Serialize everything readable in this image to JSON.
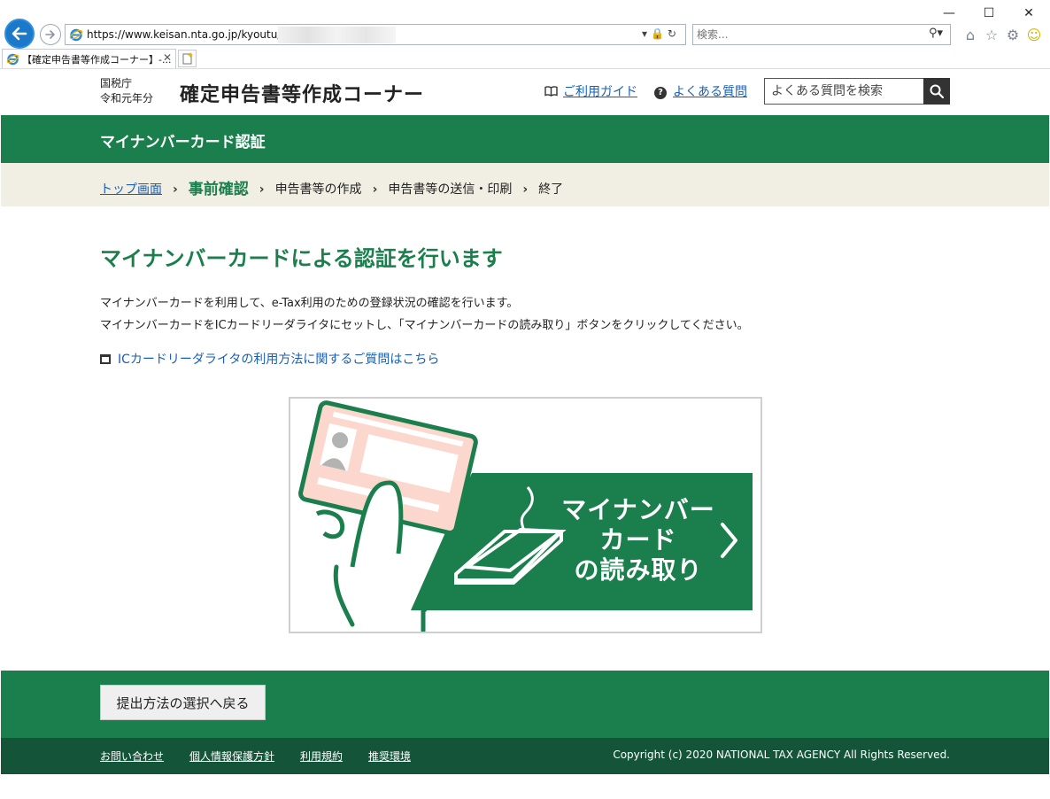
{
  "browser": {
    "url": "https://www.keisan.nta.go.jp/kyoutu/ky/",
    "search_placeholder": "検索...",
    "tab_title": "【確定申告書等作成コーナー】-...",
    "window_controls": {
      "minimize": "—",
      "maximize": "☐",
      "close": "✕"
    }
  },
  "header": {
    "agency_line1": "国税庁",
    "agency_line2": "令和元年分",
    "site_title": "確定申告書等作成コーナー",
    "guide_link": "ご利用ガイド",
    "faq_link": "よくある質問",
    "faq_search_placeholder": "よくある質問を検索"
  },
  "band": {
    "title": "マイナンバーカード認証"
  },
  "breadcrumb": {
    "top": "トップ画面",
    "current": "事前確認",
    "step3": "申告書等の作成",
    "step4": "申告書等の送信・印刷",
    "step5": "終了"
  },
  "main": {
    "heading": "マイナンバーカードによる認証を行います",
    "para1": "マイナンバーカードを利用して、e-Tax利用のための登録状況の確認を行います。",
    "para2": "マイナンバーカードをICカードリーダライタにセットし、「マイナンバーカードの読み取り」ボタンをクリックしてください。",
    "ic_faq_link": "ICカードリーダライタの利用方法に関するご質問はこちら",
    "read_button": {
      "line1": "マイナンバー",
      "line2": "カード",
      "line3": "の読み取り"
    }
  },
  "footer": {
    "back_button": "提出方法の選択へ戻る",
    "links": [
      "お問い合わせ",
      "個人情報保護方針",
      "利用規約",
      "推奨環境"
    ],
    "copyright": "Copyright (c) 2020 NATIONAL TAX AGENCY All Rights Reserved."
  },
  "colors": {
    "brand_green": "#1b7f4d",
    "footer_dark": "#14553a",
    "crumb_bg": "#f1efe3",
    "link": "#1a5fb4"
  }
}
